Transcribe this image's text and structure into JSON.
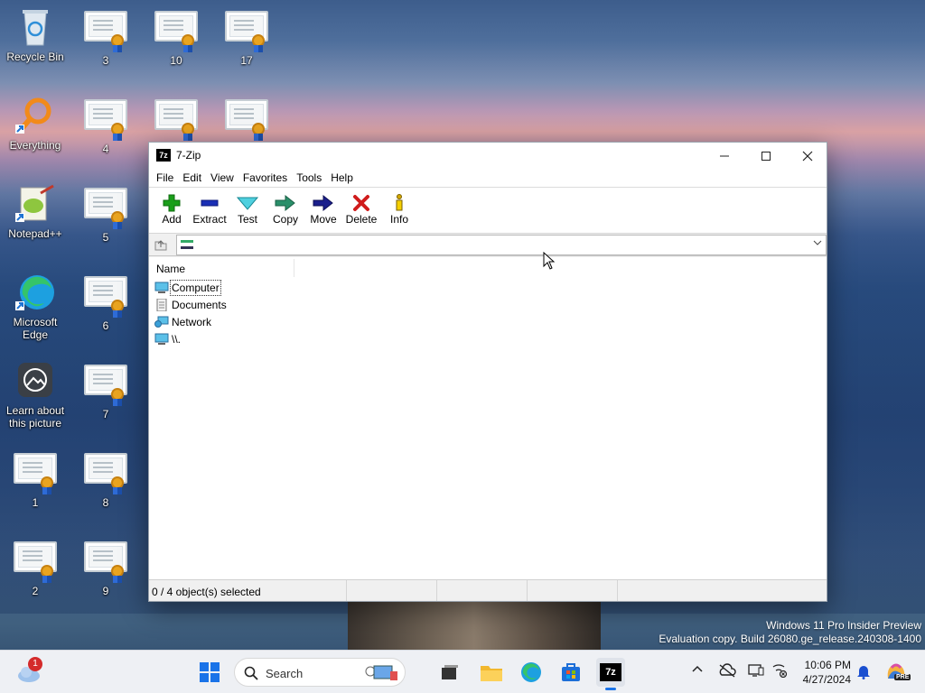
{
  "desktop": {
    "icons": [
      {
        "label": "Recycle Bin"
      },
      {
        "label": "3"
      },
      {
        "label": "10"
      },
      {
        "label": "17"
      },
      {
        "label": "Everything"
      },
      {
        "label": "4"
      },
      {
        "label": "Notepad++"
      },
      {
        "label": "5"
      },
      {
        "label": "Microsoft Edge"
      },
      {
        "label": "6"
      },
      {
        "label": "Learn about this picture"
      },
      {
        "label": "7"
      },
      {
        "label": "1"
      },
      {
        "label": "8"
      },
      {
        "label": "2"
      },
      {
        "label": "9"
      }
    ],
    "watermark": {
      "line1": "Windows 11 Pro Insider Preview",
      "line2": "Evaluation copy. Build 26080.ge_release.240308-1400"
    }
  },
  "window": {
    "title": "7-Zip",
    "app_icon_text": "7z",
    "menu": [
      "File",
      "Edit",
      "View",
      "Favorites",
      "Tools",
      "Help"
    ],
    "toolbar": [
      {
        "label": "Add",
        "icon": "plus-icon",
        "color": "#1a9e1a"
      },
      {
        "label": "Extract",
        "icon": "minus-icon",
        "color": "#1a2fb5"
      },
      {
        "label": "Test",
        "icon": "check-icon",
        "color": "#2aa3b0"
      },
      {
        "label": "Copy",
        "icon": "copy-arrow-icon",
        "color": "#2a8f6a"
      },
      {
        "label": "Move",
        "icon": "move-arrow-icon",
        "color": "#1a1f8c"
      },
      {
        "label": "Delete",
        "icon": "x-icon",
        "color": "#d01c1c"
      },
      {
        "label": "Info",
        "icon": "info-icon",
        "color": "#d4a800"
      }
    ],
    "address": {
      "value": ""
    },
    "list": {
      "column_name": "Name",
      "items": [
        {
          "name": "Computer"
        },
        {
          "name": "Documents"
        },
        {
          "name": "Network"
        },
        {
          "name": "\\\\."
        }
      ]
    },
    "status": {
      "selected": "0 / 4 object(s) selected"
    }
  },
  "taskbar": {
    "search_placeholder": "Search",
    "notification_count": "1",
    "clock": {
      "time": "10:06 PM",
      "date": "4/27/2024"
    },
    "copilot_badge": "PRE"
  }
}
